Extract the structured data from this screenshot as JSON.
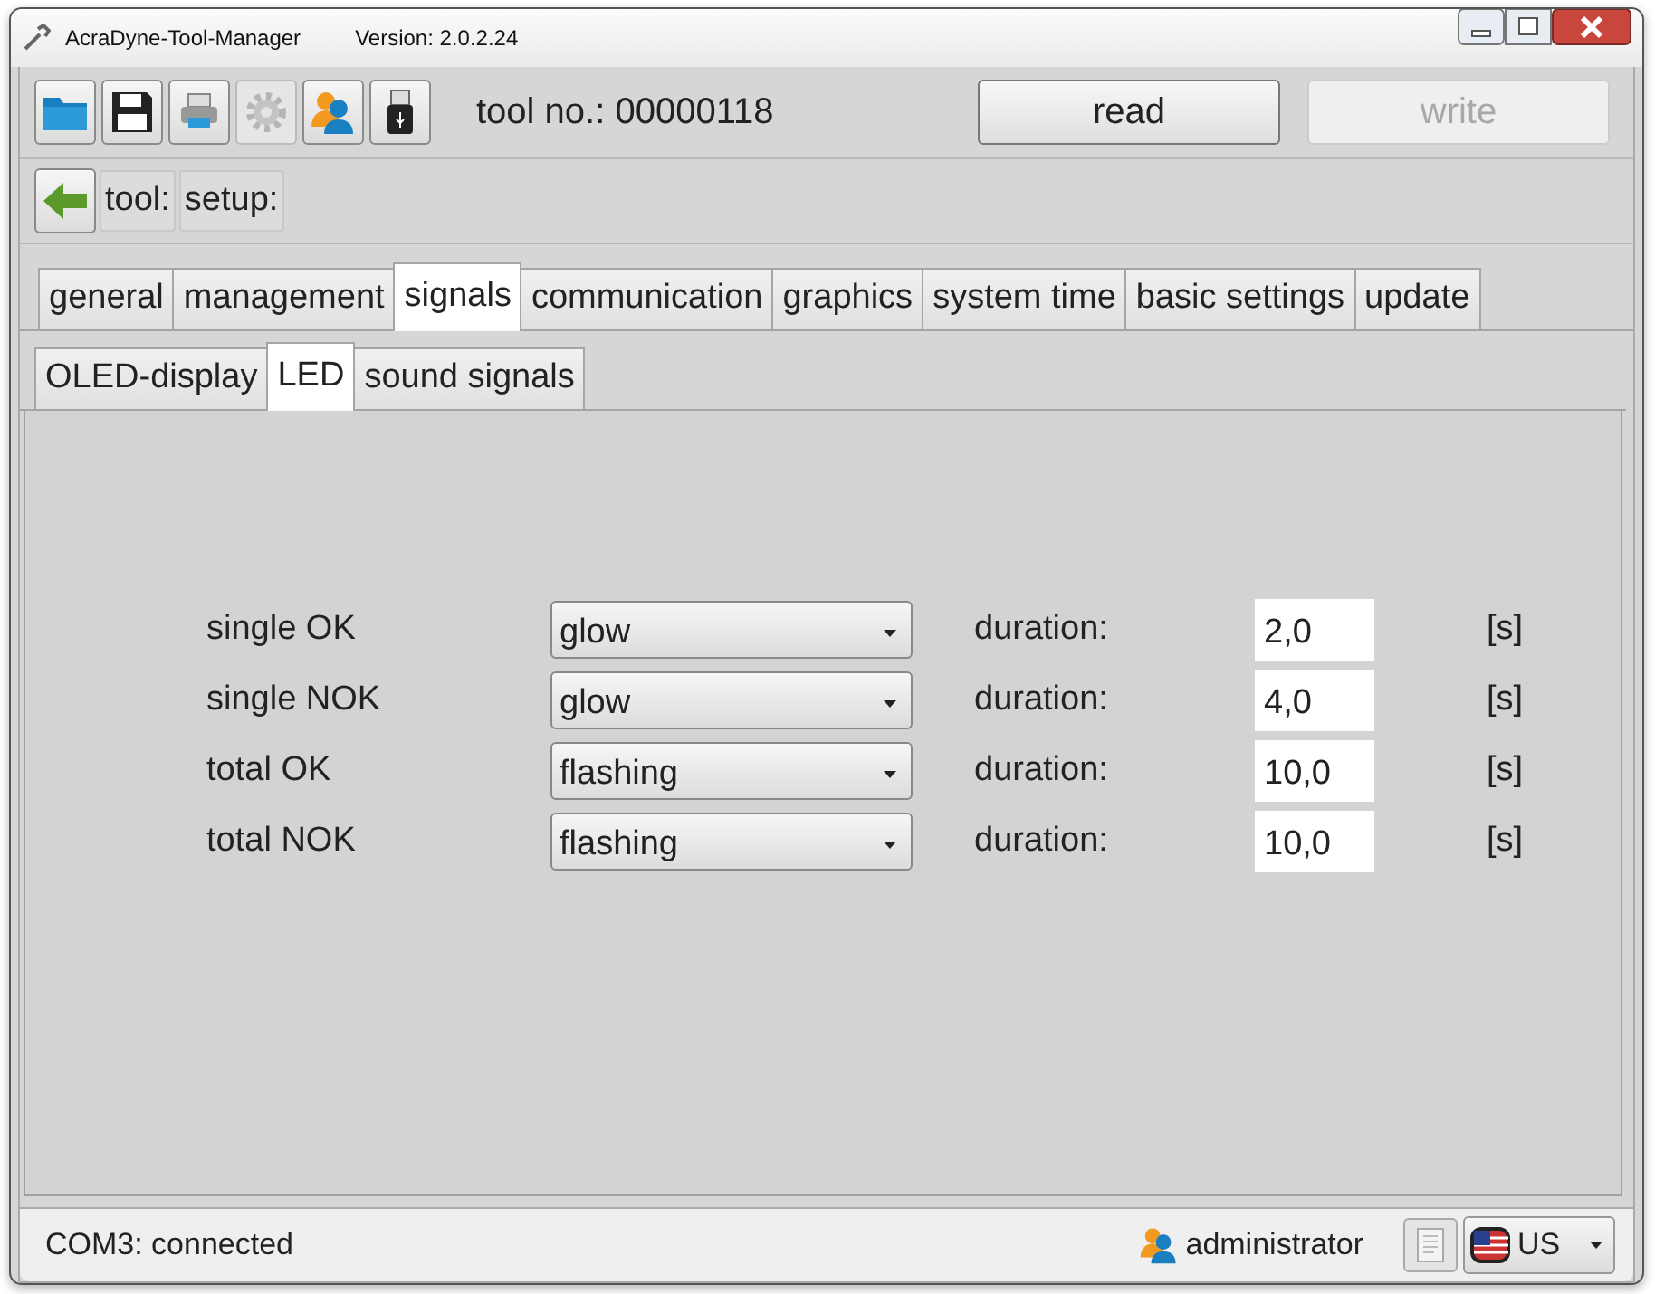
{
  "window": {
    "title": "AcraDyne-Tool-Manager",
    "version": "Version: 2.0.2.24"
  },
  "toolbar": {
    "buttons": [
      {
        "kind": "folder",
        "disabled": false
      },
      {
        "kind": "save",
        "disabled": false
      },
      {
        "kind": "print",
        "disabled": false
      },
      {
        "kind": "gear",
        "disabled": true
      },
      {
        "kind": "users",
        "disabled": false
      },
      {
        "kind": "usb",
        "disabled": false
      }
    ],
    "tool_no": "tool no.: 00000118",
    "actions": [
      {
        "label": "read",
        "disabled": false
      },
      {
        "label": "write",
        "disabled": true
      }
    ]
  },
  "breadcrumb": [
    "tool:",
    "setup:"
  ],
  "tabs": [
    {
      "label": "general",
      "selected": false
    },
    {
      "label": "management",
      "selected": false
    },
    {
      "label": "signals",
      "selected": true
    },
    {
      "label": "communication",
      "selected": false
    },
    {
      "label": "graphics",
      "selected": false
    },
    {
      "label": "system time",
      "selected": false
    },
    {
      "label": "basic settings",
      "selected": false
    },
    {
      "label": "update",
      "selected": false
    }
  ],
  "subtabs": [
    {
      "label": "OLED-display",
      "selected": false
    },
    {
      "label": "LED",
      "selected": true
    },
    {
      "label": "sound signals",
      "selected": false
    }
  ],
  "led_rows": [
    {
      "label": "single OK",
      "mode": "glow",
      "duration_label": "duration:",
      "value": "2,0",
      "unit": "[s]"
    },
    {
      "label": "single NOK",
      "mode": "glow",
      "duration_label": "duration:",
      "value": "4,0",
      "unit": "[s]"
    },
    {
      "label": "total OK",
      "mode": "flashing",
      "duration_label": "duration:",
      "value": "10,0",
      "unit": "[s]"
    },
    {
      "label": "total NOK",
      "mode": "flashing",
      "duration_label": "duration:",
      "value": "10,0",
      "unit": "[s]"
    }
  ],
  "status_bar": {
    "connection": "COM3: connected",
    "user": "administrator",
    "language": "US"
  }
}
